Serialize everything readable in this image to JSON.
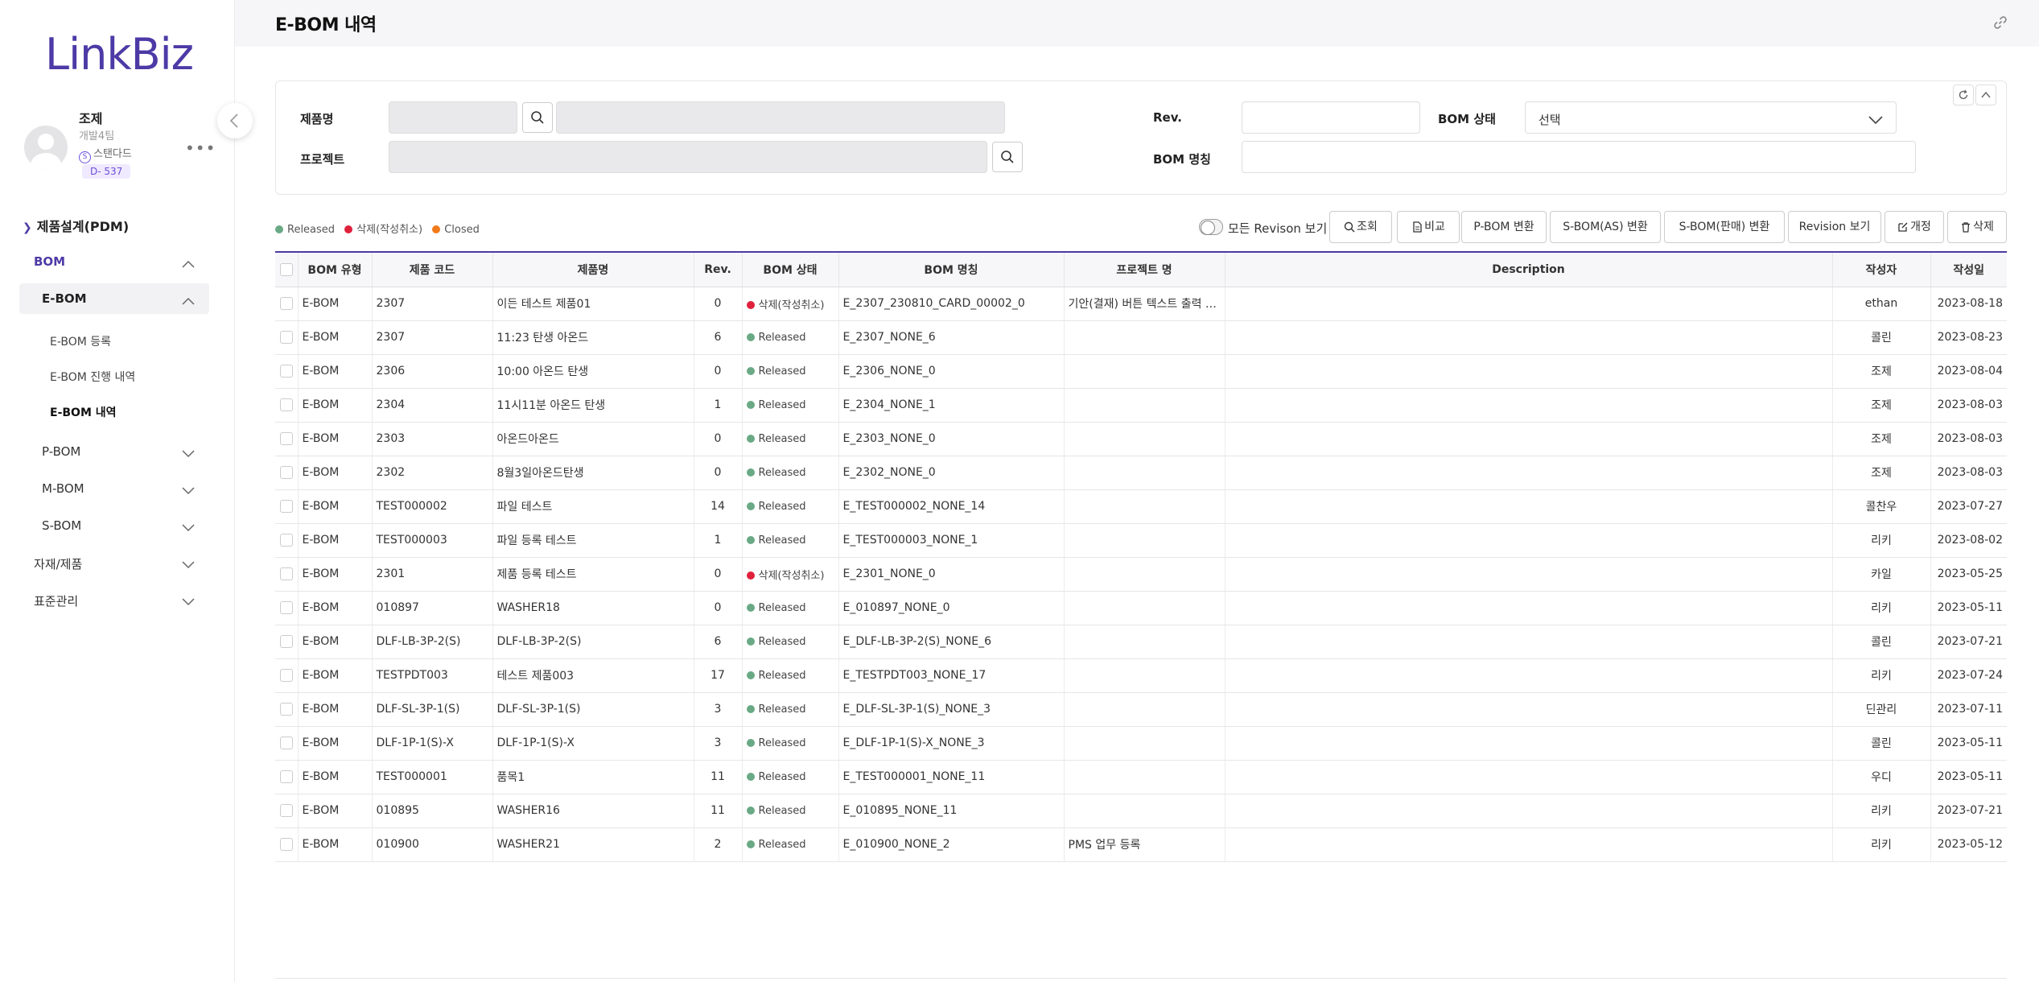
{
  "app": {
    "logo": "LinkBiz"
  },
  "profile": {
    "name": "조제",
    "team": "개발4팀",
    "grade_icon": "S",
    "grade": "스탠다드",
    "dday": "D- 537"
  },
  "nav": {
    "pdm": "제품설계(PDM)",
    "bom": "BOM",
    "ebom": "E-BOM",
    "ebom_sub": [
      "E-BOM 등록",
      "E-BOM 진행 내역",
      "E-BOM 내역"
    ],
    "pbom": "P-BOM",
    "mbom": "M-BOM",
    "sbom": "S-BOM",
    "material": "자재/제품",
    "standard": "표준관리"
  },
  "page": {
    "title": "E-BOM 내역"
  },
  "search": {
    "product_label": "제품명",
    "project_label": "프로젝트",
    "rev_label": "Rev.",
    "bom_status_label": "BOM 상태",
    "bom_status_value": "선택",
    "bom_name_label": "BOM 명칭"
  },
  "legend": {
    "released": "Released",
    "deleted": "삭제(작성취소)",
    "closed": "Closed"
  },
  "colors": {
    "released": "#6aa985",
    "deleted": "#e0213c",
    "closed": "#f07a1a",
    "accent": "#4d3aa6"
  },
  "toolbar": {
    "toggle_label": "모든 Revison 보기",
    "search": "조회",
    "compare": "비교",
    "to_pbom": "P-BOM 변환",
    "to_sbom_as": "S-BOM(AS) 변환",
    "to_sbom_sale": "S-BOM(판매) 변환",
    "revision_view": "Revision 보기",
    "revise": "개정",
    "delete": "삭제"
  },
  "table": {
    "headers": [
      "BOM 유형",
      "제품 코드",
      "제품명",
      "Rev.",
      "BOM 상태",
      "BOM 명칭",
      "프로젝트 명",
      "Description",
      "작성자",
      "작성일"
    ],
    "rows": [
      {
        "type": "E-BOM",
        "code": "2307",
        "name": "이든 테스트 제품01",
        "rev": "0",
        "status": "삭제(작성취소)",
        "status_kind": "deleted",
        "bom_name": "E_2307_230810_CARD_00002_0",
        "project": "기안(결재) 버튼 텍스트 출력 오...",
        "desc": "",
        "author": "ethan",
        "date": "2023-08-18"
      },
      {
        "type": "E-BOM",
        "code": "2307",
        "name": "11:23 탄생 아온드",
        "rev": "6",
        "status": "Released",
        "status_kind": "released",
        "bom_name": "E_2307_NONE_6",
        "project": "",
        "desc": "",
        "author": "콜린",
        "date": "2023-08-23"
      },
      {
        "type": "E-BOM",
        "code": "2306",
        "name": "10:00 아온드 탄생",
        "rev": "0",
        "status": "Released",
        "status_kind": "released",
        "bom_name": "E_2306_NONE_0",
        "project": "",
        "desc": "",
        "author": "조제",
        "date": "2023-08-04"
      },
      {
        "type": "E-BOM",
        "code": "2304",
        "name": "11시11분 아온드 탄생",
        "rev": "1",
        "status": "Released",
        "status_kind": "released",
        "bom_name": "E_2304_NONE_1",
        "project": "",
        "desc": "",
        "author": "조제",
        "date": "2023-08-03"
      },
      {
        "type": "E-BOM",
        "code": "2303",
        "name": "아온드아온드",
        "rev": "0",
        "status": "Released",
        "status_kind": "released",
        "bom_name": "E_2303_NONE_0",
        "project": "",
        "desc": "",
        "author": "조제",
        "date": "2023-08-03"
      },
      {
        "type": "E-BOM",
        "code": "2302",
        "name": "8월3일아온드탄생",
        "rev": "0",
        "status": "Released",
        "status_kind": "released",
        "bom_name": "E_2302_NONE_0",
        "project": "",
        "desc": "",
        "author": "조제",
        "date": "2023-08-03"
      },
      {
        "type": "E-BOM",
        "code": "TEST000002",
        "name": "파일 테스트",
        "rev": "14",
        "status": "Released",
        "status_kind": "released",
        "bom_name": "E_TEST000002_NONE_14",
        "project": "",
        "desc": "",
        "author": "콜찬우",
        "date": "2023-07-27"
      },
      {
        "type": "E-BOM",
        "code": "TEST000003",
        "name": "파일 등록 테스트",
        "rev": "1",
        "status": "Released",
        "status_kind": "released",
        "bom_name": "E_TEST000003_NONE_1",
        "project": "",
        "desc": "",
        "author": "리키",
        "date": "2023-08-02"
      },
      {
        "type": "E-BOM",
        "code": "2301",
        "name": "제품 등록 테스트",
        "rev": "0",
        "status": "삭제(작성취소)",
        "status_kind": "deleted",
        "bom_name": "E_2301_NONE_0",
        "project": "",
        "desc": "",
        "author": "카일",
        "date": "2023-05-25"
      },
      {
        "type": "E-BOM",
        "code": "010897",
        "name": "WASHER18",
        "rev": "0",
        "status": "Released",
        "status_kind": "released",
        "bom_name": "E_010897_NONE_0",
        "project": "",
        "desc": "",
        "author": "리키",
        "date": "2023-05-11"
      },
      {
        "type": "E-BOM",
        "code": "DLF-LB-3P-2(S)",
        "name": "DLF-LB-3P-2(S)",
        "rev": "6",
        "status": "Released",
        "status_kind": "released",
        "bom_name": "E_DLF-LB-3P-2(S)_NONE_6",
        "project": "",
        "desc": "",
        "author": "콜린",
        "date": "2023-07-21"
      },
      {
        "type": "E-BOM",
        "code": "TESTPDT003",
        "name": "테스트 제품003",
        "rev": "17",
        "status": "Released",
        "status_kind": "released",
        "bom_name": "E_TESTPDT003_NONE_17",
        "project": "",
        "desc": "",
        "author": "리키",
        "date": "2023-07-24"
      },
      {
        "type": "E-BOM",
        "code": "DLF-SL-3P-1(S)",
        "name": "DLF-SL-3P-1(S)",
        "rev": "3",
        "status": "Released",
        "status_kind": "released",
        "bom_name": "E_DLF-SL-3P-1(S)_NONE_3",
        "project": "",
        "desc": "",
        "author": "딘관리",
        "date": "2023-07-11"
      },
      {
        "type": "E-BOM",
        "code": "DLF-1P-1(S)-X",
        "name": "DLF-1P-1(S)-X",
        "rev": "3",
        "status": "Released",
        "status_kind": "released",
        "bom_name": "E_DLF-1P-1(S)-X_NONE_3",
        "project": "",
        "desc": "",
        "author": "콜린",
        "date": "2023-05-11"
      },
      {
        "type": "E-BOM",
        "code": "TEST000001",
        "name": "품목1",
        "rev": "11",
        "status": "Released",
        "status_kind": "released",
        "bom_name": "E_TEST000001_NONE_11",
        "project": "",
        "desc": "",
        "author": "우디",
        "date": "2023-05-11"
      },
      {
        "type": "E-BOM",
        "code": "010895",
        "name": "WASHER16",
        "rev": "11",
        "status": "Released",
        "status_kind": "released",
        "bom_name": "E_010895_NONE_11",
        "project": "",
        "desc": "",
        "author": "리키",
        "date": "2023-07-21"
      },
      {
        "type": "E-BOM",
        "code": "010900",
        "name": "WASHER21",
        "rev": "2",
        "status": "Released",
        "status_kind": "released",
        "bom_name": "E_010900_NONE_2",
        "project": "PMS 업무 등록",
        "desc": "",
        "author": "리키",
        "date": "2023-05-12"
      }
    ]
  }
}
